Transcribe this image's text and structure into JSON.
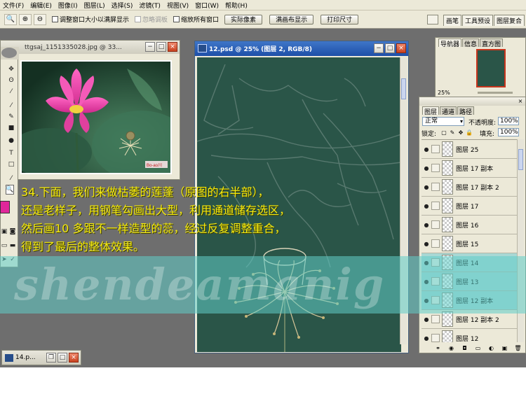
{
  "menubar": {
    "items": [
      "文件(F)",
      "编辑(E)",
      "图像(I)",
      "图层(L)",
      "选择(S)",
      "滤镜(T)",
      "视图(V)",
      "窗口(W)",
      "帮助(H)"
    ]
  },
  "options": {
    "check_resize": "调整窗口大小以满屏显示",
    "check_ignore": "忽略调板",
    "check_zoom_all": "缩放所有窗口",
    "btn_actual": "实际像素",
    "btn_fit": "满画布显示",
    "btn_print": "打印尺寸"
  },
  "palette_well": [
    "画笔",
    "工具预设",
    "图层复合"
  ],
  "photo_window": {
    "title": "ttgsaj_1151335028.jpg @ 33...",
    "stamp": "Bo-ao川"
  },
  "psd_window": {
    "title": "12.psd @ 25% (图层 2, RGB/8)"
  },
  "navigator": {
    "tabs": [
      "导航器",
      "信息",
      "直方图"
    ],
    "zoom": "25%"
  },
  "layers": {
    "tabs": [
      "图层",
      "通道",
      "路径"
    ],
    "blend_mode": "正常",
    "opacity_label": "不透明度:",
    "opacity_value": "100%",
    "lock_label": "锁定:",
    "fill_label": "填充:",
    "fill_value": "100%",
    "items": [
      {
        "name": "图层 25",
        "highlight": false
      },
      {
        "name": "图层 17 副本",
        "highlight": false
      },
      {
        "name": "图层 17 副本 2",
        "highlight": false
      },
      {
        "name": "图层 17",
        "highlight": false
      },
      {
        "name": "图层 16",
        "highlight": false
      },
      {
        "name": "图层 15",
        "highlight": false
      },
      {
        "name": "图层 14",
        "highlight": true
      },
      {
        "name": "图层 13",
        "highlight": true
      },
      {
        "name": "图层 12 副本",
        "highlight": true
      },
      {
        "name": "图层 12 副本 2",
        "highlight": false
      },
      {
        "name": "图层 12",
        "highlight": false
      }
    ]
  },
  "mini_window": {
    "title": "14.p..."
  },
  "tutorial": {
    "lines": [
      "34.下面，我们来做枯萎的莲蓬（原图的右半部），",
      "还是老样子，用钢笔勾画出大型，利用通道储存选区，",
      "然后画10 多跟不一样造型的蕊，经过反复调整重合，",
      "得到了最后的整体效果。"
    ]
  },
  "watermark": "shendeamanig",
  "colors": {
    "canvas": "#2a5548",
    "tutorial_text": "#f5ea10",
    "band": "#60cdc8",
    "foreground_swatch": "#e0279a",
    "background_swatch": "#2e6a55"
  }
}
